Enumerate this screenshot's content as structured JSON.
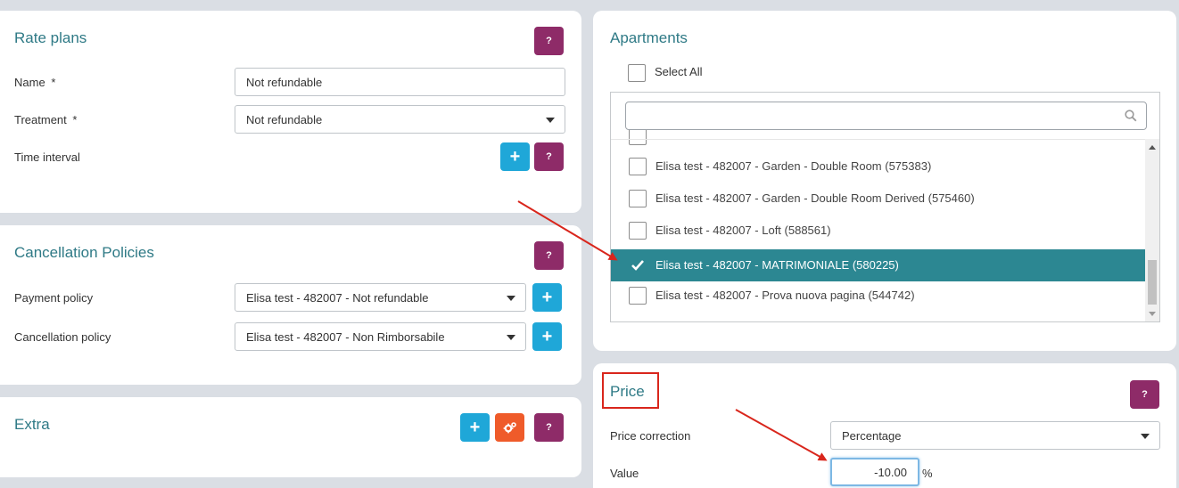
{
  "rate_plans": {
    "title": "Rate plans",
    "help_label": "?",
    "name_label": "Name",
    "name_value": "Not refundable",
    "treatment_label": "Treatment",
    "treatment_value": "Not refundable",
    "required_mark": "*",
    "time_interval_label": "Time interval",
    "add_label": "+"
  },
  "cancellation": {
    "title": "Cancellation Policies",
    "help_label": "?",
    "payment_label": "Payment policy",
    "payment_value": "Elisa test - 482007 - Not refundable",
    "cancellation_label": "Cancellation policy",
    "cancellation_value": "Elisa test - 482007 - Non Rimborsabile",
    "add_label": "+"
  },
  "extra": {
    "title": "Extra",
    "add_label": "+",
    "gear_icon": "gears-icon",
    "help_label": "?"
  },
  "apartments": {
    "title": "Apartments",
    "select_all_label": "Select All",
    "search_placeholder": "",
    "items": [
      {
        "label": "Elisa test - 482007 - Garden - Double Room (575383)",
        "checked": false
      },
      {
        "label": "Elisa test - 482007 - Garden - Double Room Derived (575460)",
        "checked": false
      },
      {
        "label": "Elisa test - 482007 - Loft (588561)",
        "checked": false
      },
      {
        "label": "Elisa test - 482007 - MATRIMONIALE (580225)",
        "checked": true
      },
      {
        "label": "Elisa test - 482007 - Prova nuova pagina (544742)",
        "checked": false
      }
    ]
  },
  "price": {
    "title": "Price",
    "help_label": "?",
    "correction_label": "Price correction",
    "correction_value": "Percentage",
    "value_label": "Value",
    "value": "-10.00",
    "unit": "%"
  },
  "colors": {
    "accent_teal": "#2c8792",
    "help_purple": "#8e2b68",
    "add_blue": "#1fa7d8",
    "gear_orange": "#ef5b2a",
    "annotation_red": "#d9261c"
  }
}
